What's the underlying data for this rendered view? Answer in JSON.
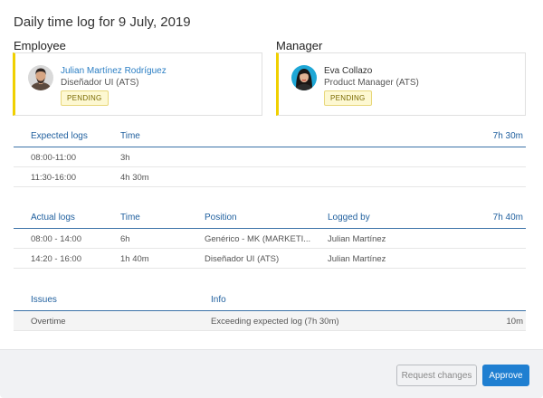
{
  "dialog": {
    "title": "Daily time log for 9 July, 2019"
  },
  "employee": {
    "section_label": "Employee",
    "name": "Julian Martínez Rodríguez",
    "role": "Diseñador UI (ATS)",
    "status": "PENDING",
    "status_color": "#f0d000"
  },
  "manager": {
    "section_label": "Manager",
    "name": "Eva Collazo",
    "role": "Product Manager (ATS)",
    "status": "PENDING",
    "status_color": "#f0d000"
  },
  "expected_logs": {
    "headers": {
      "logs": "Expected logs",
      "time": "Time",
      "total": "7h 30m"
    },
    "rows": [
      {
        "range": "08:00-11:00",
        "time": "3h"
      },
      {
        "range": "11:30-16:00",
        "time": "4h 30m"
      }
    ]
  },
  "actual_logs": {
    "headers": {
      "logs": "Actual logs",
      "time": "Time",
      "position": "Position",
      "logged_by": "Logged by",
      "total": "7h 40m"
    },
    "rows": [
      {
        "range": "08:00 - 14:00",
        "time": "6h",
        "position": "Genérico - MK (MARKETI...",
        "logged_by": "Julian Martínez"
      },
      {
        "range": "14:20 - 16:00",
        "time": "1h 40m",
        "position": "Diseñador UI (ATS)",
        "logged_by": "Julian Martínez"
      }
    ]
  },
  "issues": {
    "headers": {
      "issues": "Issues",
      "info": "Info"
    },
    "rows": [
      {
        "issue": "Overtime",
        "info": "Exceeding expected log (7h 30m)",
        "amount": "10m"
      }
    ]
  },
  "footer": {
    "request_changes_label": "Request changes",
    "approve_label": "Approve",
    "accent_color": "#1f7fd1"
  }
}
